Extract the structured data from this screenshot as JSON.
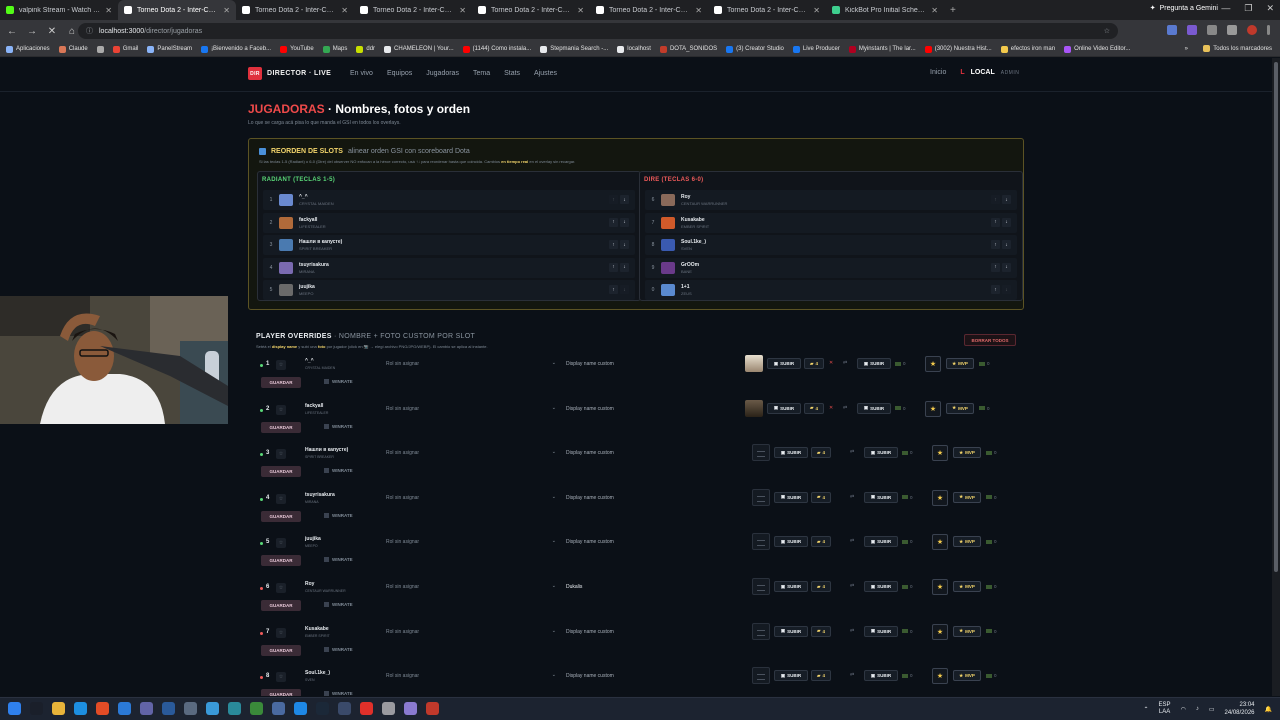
{
  "browser": {
    "tabs": [
      {
        "title": "valpink Stream - Watch Liv",
        "color": "#53fc18",
        "active": false
      },
      {
        "title": "Torneo Dota 2 - Inter-Comunid",
        "color": "#ffffff",
        "active": true
      },
      {
        "title": "Torneo Dota 2 - Inter-Comunid",
        "color": "#ffffff",
        "active": false
      },
      {
        "title": "Torneo Dota 2 - Inter-Comunid",
        "color": "#ffffff",
        "active": false
      },
      {
        "title": "Torneo Dota 2 - Inter-Comunid",
        "color": "#ffffff",
        "active": false
      },
      {
        "title": "Torneo Dota 2 - Inter-Comunid",
        "color": "#ffffff",
        "active": false
      },
      {
        "title": "Torneo Dota 2 - Inter-Comunid",
        "color": "#ffffff",
        "active": false
      },
      {
        "title": "KickBot Pro Initial Schema | SQ",
        "color": "#3ecf8e",
        "active": false
      }
    ],
    "gemini_label": "Pregunta a Gemini",
    "url_host": "localhost:3000",
    "url_path": "/director/jugadoras",
    "bookmarks": [
      {
        "label": "Aplicaciones",
        "color": "#8ab4f8"
      },
      {
        "label": "Claude",
        "color": "#d97757"
      },
      {
        "label": "",
        "color": "#aaaaaa"
      },
      {
        "label": "Gmail",
        "color": "#ea4335"
      },
      {
        "label": "PanelStream",
        "color": "#8ab4f8"
      },
      {
        "label": "¡Bienvenido a Faceb...",
        "color": "#1877f2"
      },
      {
        "label": "YouTube",
        "color": "#ff0000"
      },
      {
        "label": "Maps",
        "color": "#34a853"
      },
      {
        "label": "ddr",
        "color": "#c8e000"
      },
      {
        "label": "CHAMELEON | Your...",
        "color": "#e8eaed"
      },
      {
        "label": "(1144) Como instala...",
        "color": "#ff0000"
      },
      {
        "label": "Stepmania Search -...",
        "color": "#e8eaed"
      },
      {
        "label": "localhost",
        "color": "#e8eaed"
      },
      {
        "label": "DOTA_SONIDOS",
        "color": "#c23c2a"
      },
      {
        "label": "(3) Creator Studio",
        "color": "#1877f2"
      },
      {
        "label": "Live Producer",
        "color": "#1877f2"
      },
      {
        "label": "Myinstants | The lar...",
        "color": "#b00020"
      },
      {
        "label": "(3002) Nuestra Hist...",
        "color": "#ff0000"
      },
      {
        "label": "efectos iron man",
        "color": "#f2c94c"
      },
      {
        "label": "Online Video Editor...",
        "color": "#a855f7"
      }
    ],
    "bookmarks_all": "Todos los marcadores"
  },
  "app": {
    "brand": "DIRECTOR · LIVE",
    "brand_logo": "DIR",
    "menu": [
      "En vivo",
      "Equipos",
      "Jugadoras",
      "Tema",
      "Stats",
      "Ajustes"
    ],
    "nav_inicio": "Inicio",
    "nav_l": "L",
    "nav_local": "LOCAL",
    "nav_admin": "ADMIN",
    "title_red": "JUGADORAS",
    "title_rest": " · Nombres, fotos y orden",
    "subtitle": "Lo que se carga acá pisa lo que manda el GSI en todos los overlays.",
    "reorder": {
      "title": "REORDEN DE SLOTS",
      "title_sub": "alinear orden GSI con scoreboard Dota",
      "desc_a": "Si las teclas 1-5 (Radiant) o 6-0 (Dire) del observer NO enfocan a la héroe correcto, usá ↑↓ para reordenar hasta que coincida. Cambios",
      "desc_b": "en tiempo real",
      "desc_c": "en el overlay sin recargar.",
      "radiant_title": "RADIANT (TECLAS 1-5)",
      "dire_title": "DIRE (TECLAS 6-0)",
      "radiant": [
        {
          "num": "1",
          "player": "^_^",
          "hero": "CRYSTAL MAIDEN",
          "color": "#6a8ad0"
        },
        {
          "num": "2",
          "player": "fackyall",
          "hero": "LIFESTEALER",
          "color": "#b06a3a"
        },
        {
          "num": "3",
          "player": "Нашли в капусте)",
          "hero": "SPIRIT BREAKER",
          "color": "#4a7ab0"
        },
        {
          "num": "4",
          "player": "tsuyrisakura",
          "hero": "MIRANA",
          "color": "#7a6ab0"
        },
        {
          "num": "5",
          "player": "juujika",
          "hero": "MEEPO",
          "color": "#6a6a6a"
        }
      ],
      "dire": [
        {
          "num": "6",
          "player": "Roy",
          "hero": "CENTAUR WARRUNNER",
          "color": "#8a6a5a"
        },
        {
          "num": "7",
          "player": "Kusakabe",
          "hero": "EMBER SPIRIT",
          "color": "#d05a2a"
        },
        {
          "num": "8",
          "player": "Soul.1ke_)",
          "hero": "SVEN",
          "color": "#3a5ab0"
        },
        {
          "num": "9",
          "player": "GrOOm",
          "hero": "BANE",
          "color": "#6a3a8a"
        },
        {
          "num": "0",
          "player": "1+1",
          "hero": "ZEUS",
          "color": "#5a8ad0"
        }
      ]
    },
    "overrides": {
      "title": "PLAYER OVERRIDES",
      "title_sub": "· NOMBRE + FOTO CUSTOM POR SLOT",
      "desc_a": "Setéá el",
      "desc_b": "display name",
      "desc_c": "y subí una",
      "desc_d": "foto",
      "desc_e": "por jugador (click en 📷 → elegí archivo PNG/JPG/WEBP). El cambio se aplica al instante.",
      "borrar_label": "BORRAR TODOS",
      "role_placeholder": "Rol sin asignar",
      "display_placeholder": "Display name custom",
      "guardar_label": "GUARDAR",
      "winrate_label": "WINRATE",
      "subir_label": "SUBIR",
      "mvp_label": "MVP",
      "upload_count": "4",
      "zero_count": "0",
      "rows": [
        {
          "num": "1",
          "player": "^_^",
          "hero": "CRYSTAL MAIDEN",
          "display": "",
          "photo": "face1",
          "dot": "#5ad878"
        },
        {
          "num": "2",
          "player": "fackyall",
          "hero": "LIFESTEALER",
          "display": "",
          "photo": "face2",
          "dot": "#5ad878"
        },
        {
          "num": "3",
          "player": "Нашли в капусте)",
          "hero": "SPIRIT BREAKER",
          "display": "",
          "photo": "empty",
          "dot": "#5ad878"
        },
        {
          "num": "4",
          "player": "tsuyrisakura",
          "hero": "MIRANA",
          "display": "",
          "photo": "empty",
          "dot": "#5ad878"
        },
        {
          "num": "5",
          "player": "juujika",
          "hero": "MEEPO",
          "display": "",
          "photo": "empty",
          "dot": "#5ad878"
        },
        {
          "num": "6",
          "player": "Roy",
          "hero": "CENTAUR WARRUNNER",
          "display": "Dukalis",
          "photo": "empty",
          "dot": "#ef5a5a"
        },
        {
          "num": "7",
          "player": "Kusakabe",
          "hero": "EMBER SPIRIT",
          "display": "",
          "photo": "empty",
          "dot": "#ef5a5a"
        },
        {
          "num": "8",
          "player": "Soul.1ke_)",
          "hero": "SVEN",
          "display": "",
          "photo": "empty",
          "dot": "#ef5a5a"
        }
      ]
    }
  },
  "taskbar": {
    "lang_top": "ESP",
    "lang_bottom": "LAA",
    "time": "23:04",
    "date": "24/08/2026"
  }
}
